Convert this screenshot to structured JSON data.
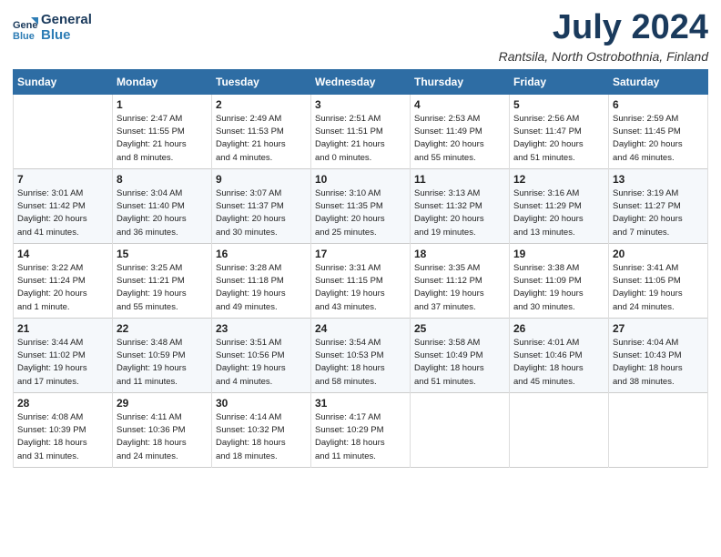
{
  "header": {
    "logo_line1": "General",
    "logo_line2": "Blue",
    "month_title": "July 2024",
    "location": "Rantsila, North Ostrobothnia, Finland"
  },
  "days_of_week": [
    "Sunday",
    "Monday",
    "Tuesday",
    "Wednesday",
    "Thursday",
    "Friday",
    "Saturday"
  ],
  "weeks": [
    [
      {
        "day": "",
        "info": ""
      },
      {
        "day": "1",
        "info": "Sunrise: 2:47 AM\nSunset: 11:55 PM\nDaylight: 21 hours\nand 8 minutes."
      },
      {
        "day": "2",
        "info": "Sunrise: 2:49 AM\nSunset: 11:53 PM\nDaylight: 21 hours\nand 4 minutes."
      },
      {
        "day": "3",
        "info": "Sunrise: 2:51 AM\nSunset: 11:51 PM\nDaylight: 21 hours\nand 0 minutes."
      },
      {
        "day": "4",
        "info": "Sunrise: 2:53 AM\nSunset: 11:49 PM\nDaylight: 20 hours\nand 55 minutes."
      },
      {
        "day": "5",
        "info": "Sunrise: 2:56 AM\nSunset: 11:47 PM\nDaylight: 20 hours\nand 51 minutes."
      },
      {
        "day": "6",
        "info": "Sunrise: 2:59 AM\nSunset: 11:45 PM\nDaylight: 20 hours\nand 46 minutes."
      }
    ],
    [
      {
        "day": "7",
        "info": "Sunrise: 3:01 AM\nSunset: 11:42 PM\nDaylight: 20 hours\nand 41 minutes."
      },
      {
        "day": "8",
        "info": "Sunrise: 3:04 AM\nSunset: 11:40 PM\nDaylight: 20 hours\nand 36 minutes."
      },
      {
        "day": "9",
        "info": "Sunrise: 3:07 AM\nSunset: 11:37 PM\nDaylight: 20 hours\nand 30 minutes."
      },
      {
        "day": "10",
        "info": "Sunrise: 3:10 AM\nSunset: 11:35 PM\nDaylight: 20 hours\nand 25 minutes."
      },
      {
        "day": "11",
        "info": "Sunrise: 3:13 AM\nSunset: 11:32 PM\nDaylight: 20 hours\nand 19 minutes."
      },
      {
        "day": "12",
        "info": "Sunrise: 3:16 AM\nSunset: 11:29 PM\nDaylight: 20 hours\nand 13 minutes."
      },
      {
        "day": "13",
        "info": "Sunrise: 3:19 AM\nSunset: 11:27 PM\nDaylight: 20 hours\nand 7 minutes."
      }
    ],
    [
      {
        "day": "14",
        "info": "Sunrise: 3:22 AM\nSunset: 11:24 PM\nDaylight: 20 hours\nand 1 minute."
      },
      {
        "day": "15",
        "info": "Sunrise: 3:25 AM\nSunset: 11:21 PM\nDaylight: 19 hours\nand 55 minutes."
      },
      {
        "day": "16",
        "info": "Sunrise: 3:28 AM\nSunset: 11:18 PM\nDaylight: 19 hours\nand 49 minutes."
      },
      {
        "day": "17",
        "info": "Sunrise: 3:31 AM\nSunset: 11:15 PM\nDaylight: 19 hours\nand 43 minutes."
      },
      {
        "day": "18",
        "info": "Sunrise: 3:35 AM\nSunset: 11:12 PM\nDaylight: 19 hours\nand 37 minutes."
      },
      {
        "day": "19",
        "info": "Sunrise: 3:38 AM\nSunset: 11:09 PM\nDaylight: 19 hours\nand 30 minutes."
      },
      {
        "day": "20",
        "info": "Sunrise: 3:41 AM\nSunset: 11:05 PM\nDaylight: 19 hours\nand 24 minutes."
      }
    ],
    [
      {
        "day": "21",
        "info": "Sunrise: 3:44 AM\nSunset: 11:02 PM\nDaylight: 19 hours\nand 17 minutes."
      },
      {
        "day": "22",
        "info": "Sunrise: 3:48 AM\nSunset: 10:59 PM\nDaylight: 19 hours\nand 11 minutes."
      },
      {
        "day": "23",
        "info": "Sunrise: 3:51 AM\nSunset: 10:56 PM\nDaylight: 19 hours\nand 4 minutes."
      },
      {
        "day": "24",
        "info": "Sunrise: 3:54 AM\nSunset: 10:53 PM\nDaylight: 18 hours\nand 58 minutes."
      },
      {
        "day": "25",
        "info": "Sunrise: 3:58 AM\nSunset: 10:49 PM\nDaylight: 18 hours\nand 51 minutes."
      },
      {
        "day": "26",
        "info": "Sunrise: 4:01 AM\nSunset: 10:46 PM\nDaylight: 18 hours\nand 45 minutes."
      },
      {
        "day": "27",
        "info": "Sunrise: 4:04 AM\nSunset: 10:43 PM\nDaylight: 18 hours\nand 38 minutes."
      }
    ],
    [
      {
        "day": "28",
        "info": "Sunrise: 4:08 AM\nSunset: 10:39 PM\nDaylight: 18 hours\nand 31 minutes."
      },
      {
        "day": "29",
        "info": "Sunrise: 4:11 AM\nSunset: 10:36 PM\nDaylight: 18 hours\nand 24 minutes."
      },
      {
        "day": "30",
        "info": "Sunrise: 4:14 AM\nSunset: 10:32 PM\nDaylight: 18 hours\nand 18 minutes."
      },
      {
        "day": "31",
        "info": "Sunrise: 4:17 AM\nSunset: 10:29 PM\nDaylight: 18 hours\nand 11 minutes."
      },
      {
        "day": "",
        "info": ""
      },
      {
        "day": "",
        "info": ""
      },
      {
        "day": "",
        "info": ""
      }
    ]
  ]
}
